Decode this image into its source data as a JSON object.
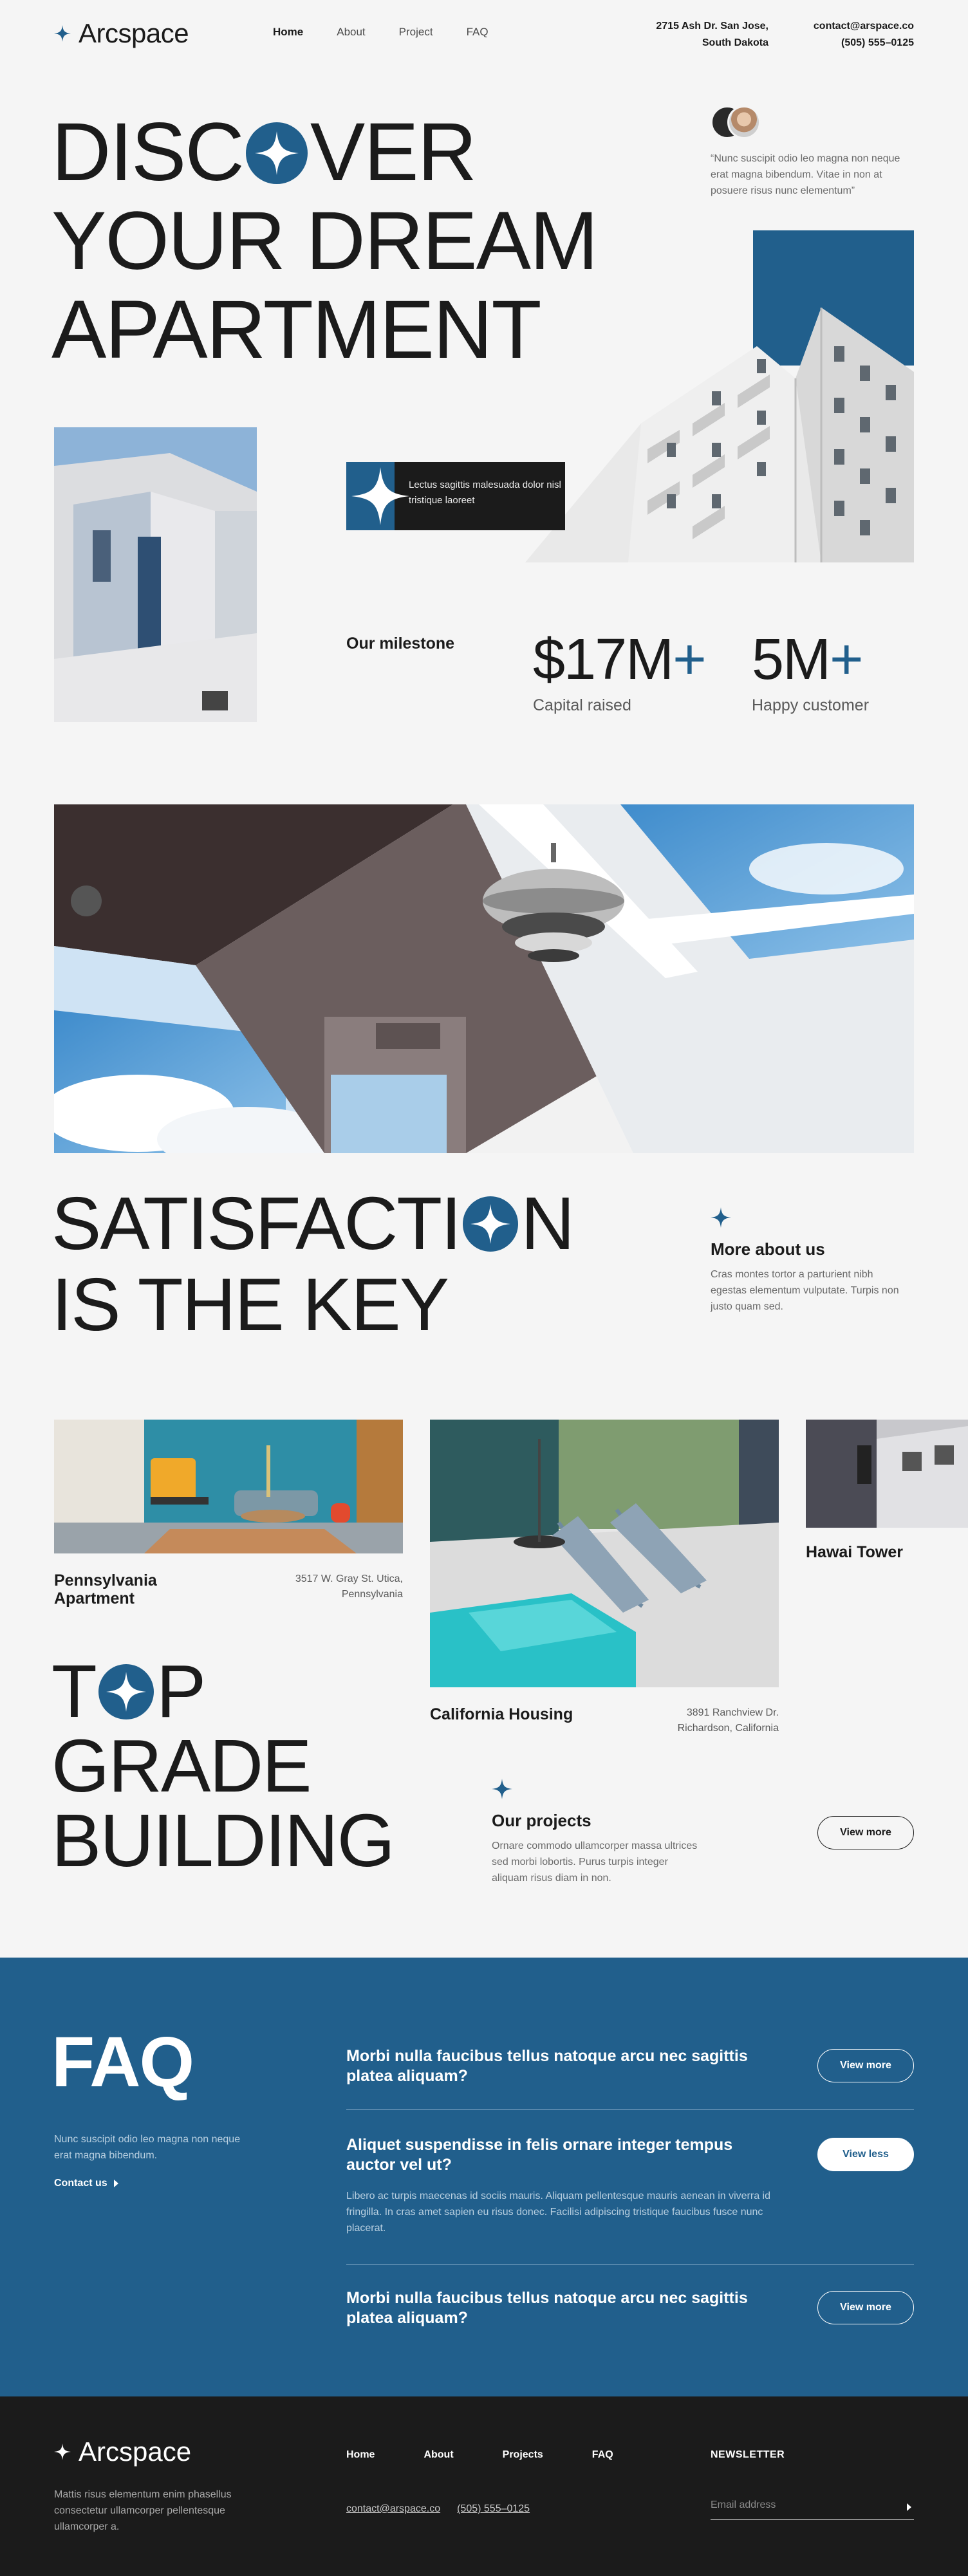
{
  "brand": {
    "name": "Arcspace",
    "icon": "four-point-star-icon",
    "accent": "#215f8c",
    "dark": "#1b1b1b",
    "bg": "#f5f5f5"
  },
  "nav": {
    "items": [
      {
        "label": "Home",
        "active": true
      },
      {
        "label": "About"
      },
      {
        "label": "Project"
      },
      {
        "label": "FAQ"
      }
    ],
    "address_line1": "2715 Ash Dr. San Jose,",
    "address_line2": "South Dakota",
    "email": "contact@arspace.co",
    "phone": "(505) 555–0125"
  },
  "hero": {
    "title_line1_a": "DISC",
    "title_line1_b": "VER",
    "title_line2": "YOUR DREAM",
    "title_line3": "APARTMENT",
    "quote": "“Nunc suscipit odio leo magna non neque erat magna bibendum. Vitae in non at posuere risus nunc elementum”",
    "tag_text": "Lectus sagittis malesuada dolor nisl tristique laoreet"
  },
  "milestone": {
    "label": "Our milestone",
    "stats": [
      {
        "value": "$17M",
        "suffix": "+",
        "label": "Capital raised"
      },
      {
        "value": "5M",
        "suffix": "+",
        "label": "Happy customer"
      }
    ]
  },
  "satisfaction": {
    "title_line1_a": "SATISFACTI",
    "title_line1_b": "N",
    "title_line2": "IS THE KEY",
    "more_title": "More about us",
    "more_text": "Cras montes tortor a parturient nibh egestas elementum vulputate. Turpis non justo quam sed."
  },
  "projects": {
    "cards": [
      {
        "name": "Pennsylvania Apartment",
        "address_line1": "3517 W. Gray St. Utica,",
        "address_line2": "Pennsylvania"
      },
      {
        "name": "California Housing",
        "address_line1": "3891 Ranchview Dr.",
        "address_line2": "Richardson, California"
      },
      {
        "name": "Hawai Tower"
      }
    ],
    "title_line1_a": "T",
    "title_line1_b": "P",
    "title_line2": "GRADE",
    "title_line3": "BUILDING",
    "section_title": "Our projects",
    "section_text": "Ornare commodo ullamcorper massa ultrices sed morbi lobortis. Purus turpis integer aliquam risus diam in non.",
    "button": "View more"
  },
  "faq": {
    "title": "FAQ",
    "subtitle": "Nunc suscipit odio leo magna non neque erat magna bibendum.",
    "contact_link": "Contact us",
    "items": [
      {
        "question": "Morbi nulla faucibus tellus natoque arcu nec sagittis platea aliquam?",
        "button": "View more"
      },
      {
        "question": "Aliquet suspendisse in felis ornare integer tempus auctor vel ut?",
        "answer": "Libero ac turpis maecenas id sociis mauris. Aliquam pellentesque mauris aenean in viverra id fringilla. In cras amet sapien eu risus donec. Facilisi adipiscing tristique faucibus fusce nunc placerat.",
        "button": "View less"
      },
      {
        "question": "Morbi nulla faucibus tellus natoque arcu nec sagittis platea aliquam?",
        "button": "View more"
      }
    ]
  },
  "footer": {
    "description": "Mattis risus elementum enim phasellus consectetur ullamcorper pellentesque ullamcorper a.",
    "menu": [
      "Home",
      "About",
      "Projects",
      "FAQ"
    ],
    "email": "contact@arspace.co",
    "phone": "(505) 555–0125",
    "newsletter_label": "NEWSLETTER",
    "email_placeholder": "Email address"
  }
}
